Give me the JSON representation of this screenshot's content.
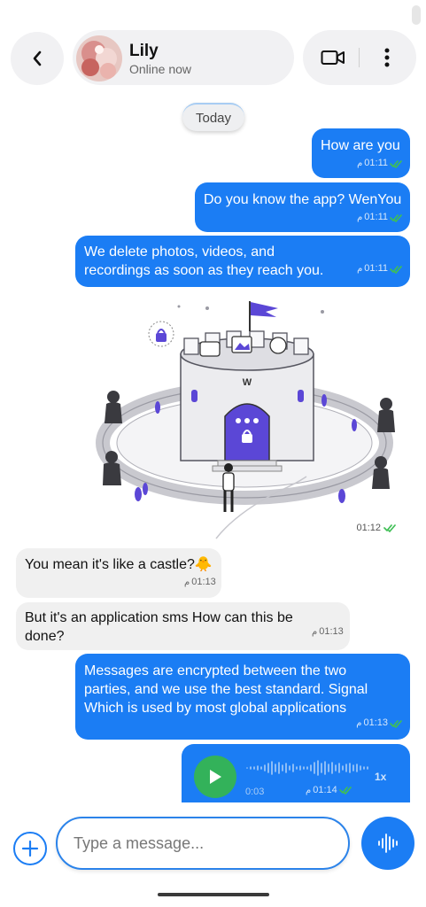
{
  "header": {
    "contact_name": "Lily",
    "contact_status": "Online now"
  },
  "chat": {
    "date_separator": "Today",
    "messages": [
      {
        "direction": "outgoing",
        "text": "How are you",
        "time": "01:11",
        "ampm": "م",
        "status": "read"
      },
      {
        "direction": "outgoing",
        "text": "Do you know the app? WenYou",
        "time": "01:11",
        "ampm": "م",
        "status": "read"
      },
      {
        "direction": "outgoing",
        "text": "We delete photos, videos, and recordings as soon as they reach you.",
        "time": "01:11",
        "ampm": "م",
        "status": "read"
      },
      {
        "direction": "outgoing",
        "type": "image",
        "image_label": "W",
        "time": "01:12",
        "ampm": "",
        "status": "read"
      },
      {
        "direction": "incoming",
        "text": "You mean it's like a castle?🐥",
        "time": "01:13",
        "ampm": "م"
      },
      {
        "direction": "incoming",
        "text": "But it's an application sms How can this be done?",
        "time": "01:13",
        "ampm": "م"
      },
      {
        "direction": "outgoing",
        "text": "Messages are encrypted between the two parties, and we use the best standard. Signal Which is used by most global applications",
        "time": "01:13",
        "ampm": "م",
        "status": "read"
      },
      {
        "direction": "outgoing",
        "type": "audio",
        "duration": "0:03",
        "speed": "1x",
        "time": "01:14",
        "ampm": "م",
        "status": "read"
      }
    ]
  },
  "composer": {
    "placeholder": "Type a message..."
  },
  "icons": {
    "back": "chevron-left-icon",
    "video": "video-camera-icon",
    "more": "more-vertical-icon",
    "add": "plus-icon",
    "mic": "voice-wave-icon",
    "play": "play-icon",
    "read_status": "double-check-icon"
  },
  "colors": {
    "outgoing_bubble": "#1b7df4",
    "incoming_bubble": "#f0f0f0",
    "read_check": "#3fbf55",
    "play_button": "#33b25a",
    "header_pill": "#f1f1f3"
  }
}
